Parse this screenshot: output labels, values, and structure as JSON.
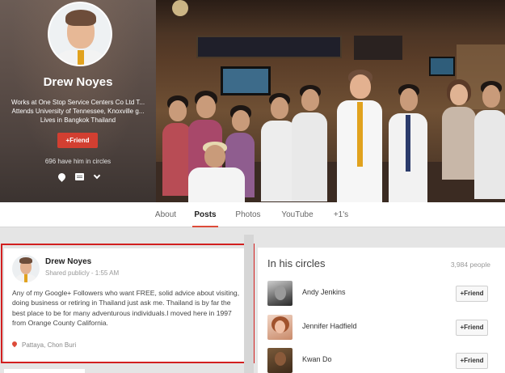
{
  "profile": {
    "name": "Drew Noyes",
    "work": "Works at One Stop Service Centers Co Ltd T...",
    "education": "Attends University of Tennessee, Knoxville g...",
    "location": "Lives in Bangkok Thailand",
    "friend_button": "+Friend",
    "circles_count": "696 have him in circles"
  },
  "tabs": [
    {
      "label": "About",
      "active": false
    },
    {
      "label": "Posts",
      "active": true
    },
    {
      "label": "Photos",
      "active": false
    },
    {
      "label": "YouTube",
      "active": false
    },
    {
      "label": "+1's",
      "active": false
    }
  ],
  "post": {
    "author": "Drew Noyes",
    "meta": "Shared publicly  -  1:55 AM",
    "text": "Any of my Google+ Followers who want FREE, solid advice about visiting, doing business or retiring in Thailand just ask me. Thailand is by far the best place to be for many adventurous individuals.I moved here in 1997 from Orange County California.",
    "location": "Pattaya, Chon Buri"
  },
  "circles": {
    "title": "In his circles",
    "count": "3,984 people",
    "people": [
      {
        "name": "Andy Jenkins",
        "button": "+Friend"
      },
      {
        "name": "Jennifer Hadfield",
        "button": "+Friend"
      },
      {
        "name": "Kwan Do",
        "button": "+Friend"
      }
    ]
  },
  "colors": {
    "accent_red": "#d23f31",
    "tab_underline": "#dd4b39",
    "highlight_box": "#d21f1f"
  },
  "icons": {
    "location": "map-pin-icon",
    "message": "message-icon",
    "more": "chevron-down-icon"
  }
}
